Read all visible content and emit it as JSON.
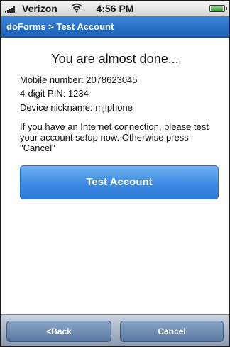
{
  "status_bar": {
    "carrier": "Verizon",
    "time": "4:56 PM",
    "icons": [
      "signal-bars-icon",
      "wifi-icon",
      "battery-icon"
    ],
    "battery_level": 0.95
  },
  "nav_bar": {
    "title": "doForms > Test Account"
  },
  "content": {
    "headline": "You are almost done...",
    "mobile_number": "Mobile number: 2078623045",
    "pin": "4-digit PIN: 1234",
    "nickname": "Device nickname: mjiphone",
    "message": "If you have an Internet connection, please test your account setup now. Otherwise press \"Cancel\"",
    "test_button_label": "Test Account"
  },
  "toolbar": {
    "back_label": "<Back",
    "cancel_label": "Cancel"
  },
  "colors": {
    "nav_bar": "#2a73c9",
    "primary_button": "#3d8be3",
    "toolbar": "#9aa8bc"
  }
}
